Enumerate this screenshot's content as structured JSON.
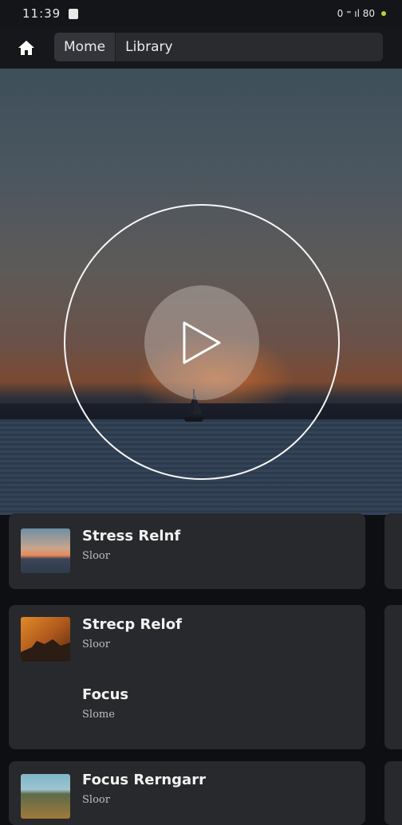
{
  "status_bar": {
    "time": "11:39",
    "right_text": "0 ⁼ ıl 80"
  },
  "nav": {
    "tabs": [
      {
        "label": "Mome"
      },
      {
        "label": "Library"
      }
    ]
  },
  "player": {
    "state": "paused"
  },
  "cards": [
    {
      "title": "Stress Relnf",
      "subtitle": "Sloor"
    },
    {
      "title": "Strecp Relof",
      "subtitle": "Sloor"
    },
    {
      "title": "Focus",
      "subtitle": "Slome"
    },
    {
      "title": "Focus Rerngarr",
      "subtitle": "Sloor"
    }
  ],
  "icons": [
    "home-icon",
    "play-icon",
    "wifi-icon",
    "signal-icon",
    "battery-icon"
  ]
}
